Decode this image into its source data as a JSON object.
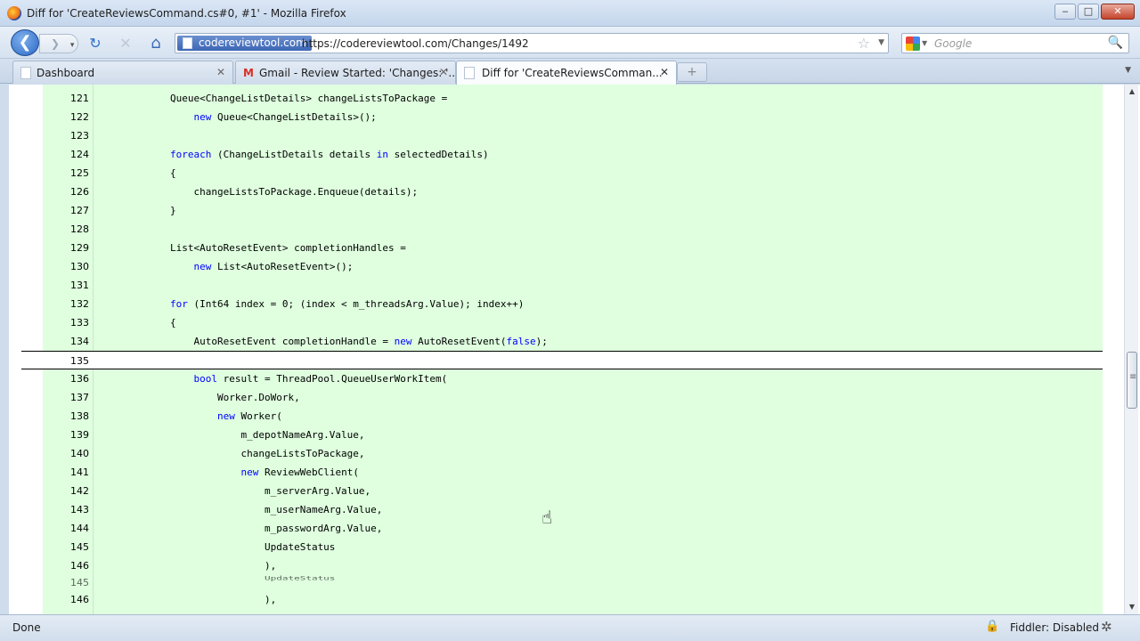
{
  "window": {
    "title": "Diff for 'CreateReviewsCommand.cs#0, #1' - Mozilla Firefox",
    "minimize": "‒",
    "maximize": "□",
    "close": "✕"
  },
  "nav": {
    "back": "❮",
    "forward": "❯",
    "forward_drop": "▾",
    "reload": "↻",
    "stop": "✕",
    "home": "⌂",
    "site_identity": "codereviewtool.com",
    "url": "https://codereviewtool.com/Changes/1492",
    "bookmark_star": "☆",
    "url_dropdown": "▼",
    "search_placeholder": "Google",
    "search_drop": "▼",
    "search_button": "🔍"
  },
  "tabs": [
    {
      "label": "Dashboard",
      "close": "✕"
    },
    {
      "label": "Gmail - Review Started: 'Changes: '...",
      "icon": "M",
      "close": "✕"
    },
    {
      "label": "Diff for 'CreateReviewsComman...",
      "close": "✕"
    }
  ],
  "new_tab": "+",
  "tab_list": "▼",
  "diff": {
    "lines": [
      {
        "num": "121",
        "code": "Queue<ChangeListDetails> changeListsToPackage ="
      },
      {
        "num": "122",
        "pre": "    ",
        "kw": "new",
        "code": " Queue<ChangeListDetails>();"
      },
      {
        "num": "123",
        "code": ""
      },
      {
        "num": "124",
        "kw": "foreach",
        "code": " (ChangeListDetails details ",
        "kw2": "in",
        "code2": " selectedDetails)"
      },
      {
        "num": "125",
        "code": "{"
      },
      {
        "num": "126",
        "code": "    changeListsToPackage.Enqueue(details);"
      },
      {
        "num": "127",
        "code": "}"
      },
      {
        "num": "128",
        "code": ""
      },
      {
        "num": "129",
        "code": "List<AutoResetEvent> completionHandles ="
      },
      {
        "num": "130",
        "pre": "    ",
        "kw": "new",
        "code": " List<AutoResetEvent>();"
      },
      {
        "num": "131",
        "code": ""
      },
      {
        "num": "132",
        "kw": "for",
        "code": " (Int64 index = 0; (index < m_threadsArg.Value); index++)"
      },
      {
        "num": "133",
        "code": "{"
      },
      {
        "num": "134",
        "code": "    AutoResetEvent completionHandle = ",
        "kw2": "new",
        "code2": " AutoResetEvent(",
        "kw3": "false",
        "code3": ");"
      },
      {
        "num": "135",
        "code": ""
      },
      {
        "num": "136",
        "pre": "    ",
        "kw": "bool",
        "code": " result = ThreadPool.QueueUserWorkItem("
      },
      {
        "num": "137",
        "code": "        Worker.DoWork,"
      },
      {
        "num": "138",
        "pre": "        ",
        "kw": "new",
        "code": " Worker("
      },
      {
        "num": "139",
        "code": "            m_depotNameArg.Value,"
      },
      {
        "num": "140",
        "code": "            changeListsToPackage,"
      },
      {
        "num": "141",
        "pre": "            ",
        "kw": "new",
        "code": " ReviewWebClient("
      },
      {
        "num": "142",
        "code": "                m_serverArg.Value,"
      },
      {
        "num": "143",
        "code": "                m_userNameArg.Value,"
      },
      {
        "num": "144",
        "code": "                m_passwordArg.Value,"
      },
      {
        "num": "145",
        "code": "                UpdateStatus"
      },
      {
        "num": "146",
        "code": "                ),"
      }
    ],
    "ghost_lines": [
      {
        "num": "145",
        "code": "                UpdateStatus"
      },
      {
        "num": "146",
        "code": "                ),"
      }
    ]
  },
  "scroll": {
    "up": "▲",
    "down": "▼",
    "position": 0.52
  },
  "status": {
    "text": "Done",
    "lock": "🔒",
    "fiddler": "Fiddler: Disabled",
    "gear": "✲"
  },
  "colors": {
    "added_bg": "#dfffdf",
    "keyword": "#0000ff"
  }
}
